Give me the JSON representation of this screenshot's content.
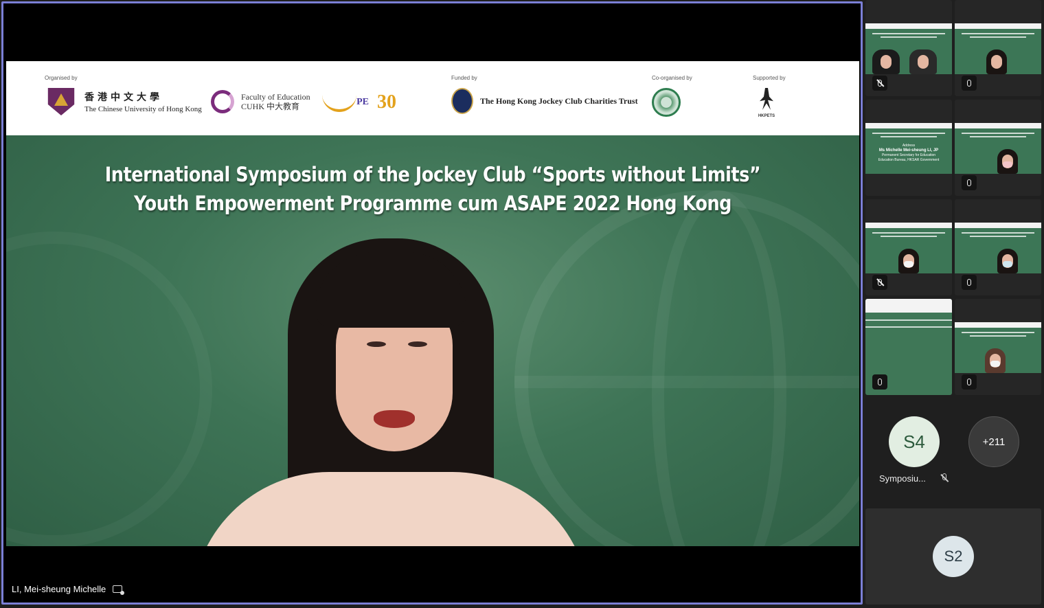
{
  "banner": {
    "organised_by": "Organised by",
    "cuhk_zh": "香港中文大學",
    "cuhk_en": "The Chinese University of Hong Kong",
    "foe_line1": "Faculty of Education",
    "foe_line2": "CUHK 中大教育",
    "spe": "PE",
    "thirty": "30",
    "funded_by": "Funded by",
    "hkjc": "The Hong Kong Jockey Club Charities Trust",
    "co_organised_by": "Co-organised by",
    "supported_by": "Supported by",
    "hkpets": "HKPETS"
  },
  "stage": {
    "title_line1": "International Symposium of the Jockey Club “Sports without Limits”",
    "title_line2": "Youth Empowerment Programme cum ASAPE 2022 Hong Kong",
    "speaker_name": "LI, Mei-sheung Michelle"
  },
  "sidebar": {
    "address_label": "Address",
    "address_name": "Ms Michelle Mei-sheung LI, JP",
    "address_role1": "Permanent Secretary for Education",
    "address_role2": "Education Bureau, HKSAR Government",
    "s4_initials": "S4",
    "s4_name": "Symposiu...",
    "more_count": "+211",
    "s2_initials": "S2"
  },
  "colors": {
    "active_border": "#7b7fd6",
    "backdrop_green": "#3e7456"
  }
}
